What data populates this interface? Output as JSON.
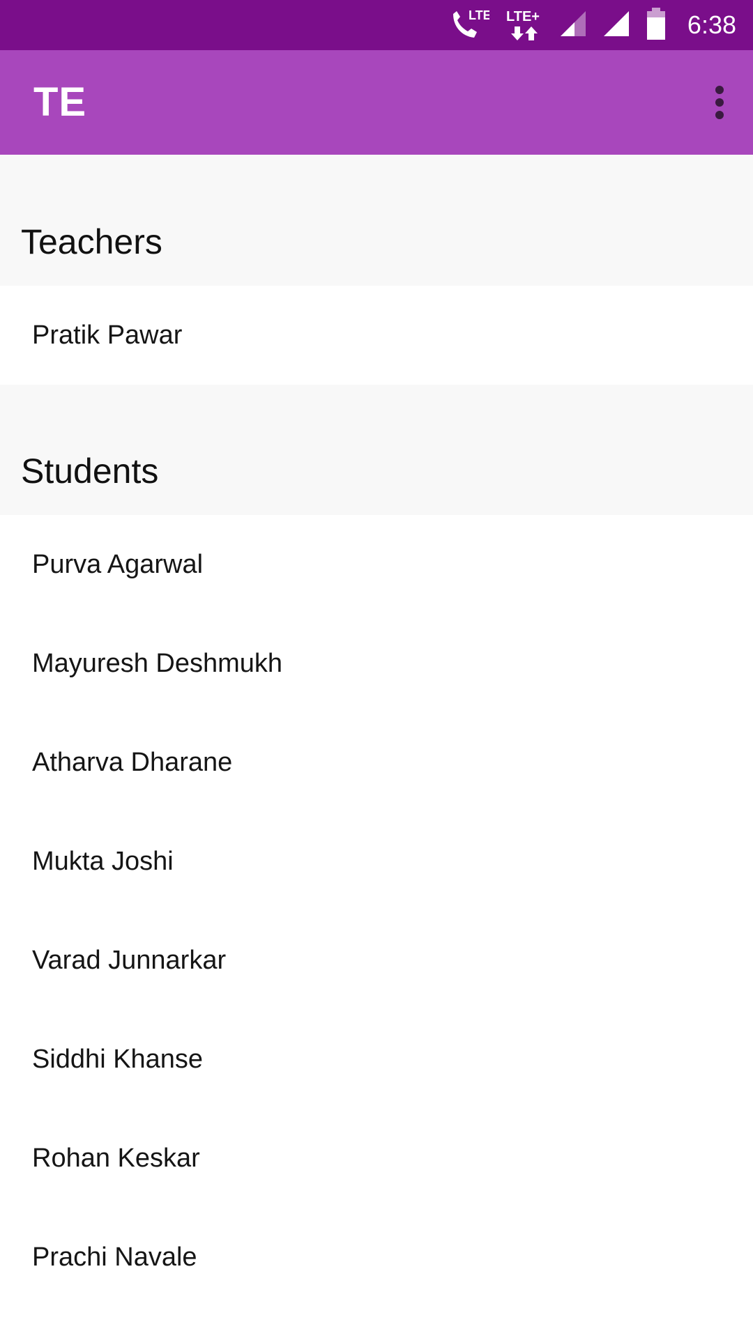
{
  "status_bar": {
    "volte_label": "LTE",
    "network_label": "LTE+",
    "time": "6:38",
    "icons": [
      "volte-call-icon",
      "lte-plus-data-icon",
      "signal-weak-icon",
      "signal-full-icon",
      "battery-icon"
    ]
  },
  "app_bar": {
    "title": "TE",
    "overflow_icon": "more-vert-icon"
  },
  "teachers": {
    "header": "Teachers",
    "items": [
      "Pratik Pawar"
    ]
  },
  "students": {
    "header": "Students",
    "items": [
      "Purva Agarwal",
      "Mayuresh Deshmukh",
      "Atharva Dharane",
      "Mukta Joshi",
      "Varad Junnarkar",
      "Siddhi Khanse",
      "Rohan Keskar",
      "Prachi Navale"
    ]
  },
  "colors": {
    "status_bar": "#7a0e8a",
    "app_bar": "#a847bc",
    "section_header_bg": "#f8f8f8"
  }
}
